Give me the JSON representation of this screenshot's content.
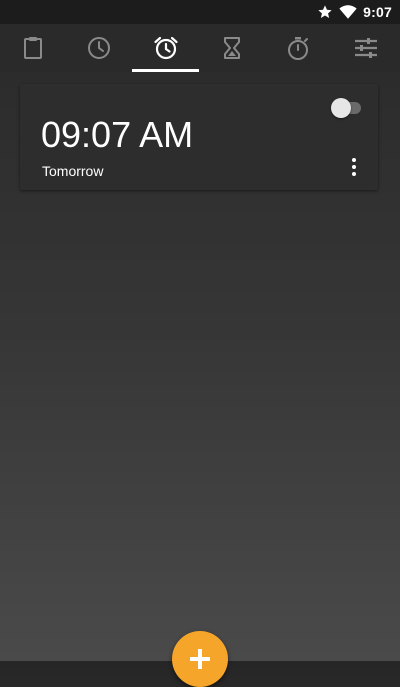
{
  "status_bar": {
    "time": "9:07",
    "icons": [
      "star-icon",
      "wifi-icon",
      "battery-icon"
    ]
  },
  "tabs": [
    {
      "name": "clipboard",
      "icon": "clipboard-icon",
      "selected": false
    },
    {
      "name": "clock",
      "icon": "clock-icon",
      "selected": false
    },
    {
      "name": "alarm",
      "icon": "alarm-clock-icon",
      "selected": true
    },
    {
      "name": "timer",
      "icon": "hourglass-icon",
      "selected": false
    },
    {
      "name": "stopwatch",
      "icon": "stopwatch-icon",
      "selected": false
    },
    {
      "name": "settings",
      "icon": "sliders-icon",
      "selected": false
    }
  ],
  "alarm": {
    "time": "09:07 AM",
    "label": "Tomorrow",
    "enabled": false
  },
  "fab": {
    "icon": "plus-icon"
  },
  "colors": {
    "background_top": "#2c2c2c",
    "background_bottom": "#4a4a4a",
    "tab_icon": "#8a8a8a",
    "tab_icon_active": "#ffffff",
    "accent": "#f4a52a",
    "card": "#2d2d2d"
  }
}
